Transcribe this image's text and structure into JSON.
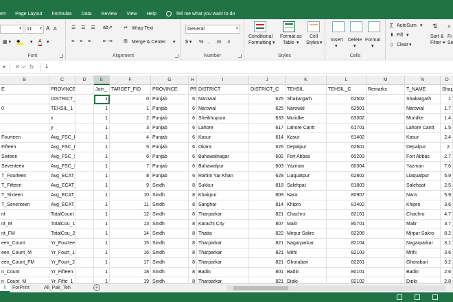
{
  "menu": {
    "items": [
      "ert",
      "Page Layout",
      "Formulas",
      "Data",
      "Review",
      "View",
      "Help"
    ],
    "tell_me": "Tell me what you want to do"
  },
  "ribbon": {
    "font_name": "",
    "font_size": "11",
    "number_format": "General",
    "wrap_text": "Wrap Text",
    "merge_center": "Merge & Center",
    "conditional_formatting_1": "Conditional",
    "conditional_formatting_2": "Formatting",
    "format_as_table_1": "Format as",
    "format_as_table_2": "Table",
    "cell_styles_1": "Cell",
    "cell_styles_2": "Styles",
    "insert": "Insert",
    "delete": "Delete",
    "format": "Format",
    "autosum": "AutoSum",
    "fill": "Fill",
    "clear": "Clear",
    "sort_filter_1": "Sort &",
    "sort_filter_2": "Filter",
    "find_select": "Fi",
    "find_select_2": "Se",
    "groups": {
      "font": "Font",
      "alignment": "Alignment",
      "number": "Number",
      "styles": "Styles",
      "cells": "Cells"
    }
  },
  "formula_bar": {
    "value": "1"
  },
  "columns": [
    "B",
    "C",
    "D",
    "E",
    "F",
    "G",
    "H",
    "I",
    "J",
    "K",
    "L",
    "M",
    "N",
    "O"
  ],
  "header_row": [
    "E",
    "PROVINCE_1",
    "",
    "Join_",
    "TARGET_FID",
    "PROVINCE",
    "PR",
    "DISTRICT",
    "DISTRICT_C",
    "TEHSIL",
    "TEHSIL_C",
    "Remarks",
    "T_NAME",
    "Shap"
  ],
  "rows": [
    [
      "",
      "DISTRICT_1",
      "",
      "1",
      "0",
      "Punjab",
      "6",
      "Narowal",
      "625",
      "Shakargarh",
      "62502",
      "",
      "Shakargarh",
      "1"
    ],
    [
      "0",
      "TEHSIL_1",
      "",
      "1",
      "1",
      "Punjab",
      "6",
      "Narowal",
      "625",
      "Narowal",
      "62501",
      "",
      "Narowal",
      "1.7"
    ],
    [
      "",
      "x",
      "",
      "1",
      "2",
      "Punjab",
      "6",
      "Sheikhupura",
      "633",
      "Muridke",
      "63302",
      "",
      "Muridke",
      "1.4"
    ],
    [
      "",
      "y",
      "",
      "1",
      "3",
      "Punjab",
      "6",
      "Lahore",
      "617",
      "Lahore Cantt",
      "61701",
      "",
      "Lahore Cantt",
      "1.5"
    ],
    [
      "Fourteen",
      "Avg_FSC_Fo",
      "",
      "1",
      "4",
      "Punjab",
      "6",
      "Kasur",
      "614",
      "Kasur",
      "61402",
      "",
      "Kasur",
      "2.4"
    ],
    [
      "Fifteen",
      "Avg_FSC_Fi",
      "",
      "1",
      "5",
      "Punjab",
      "6",
      "Okara",
      "626",
      "Depalpur",
      "62601",
      "",
      "Depalpur",
      "2."
    ],
    [
      "Sixteen",
      "Avg_FSC_Si",
      "",
      "1",
      "6",
      "Punjab",
      "6",
      "Bahawalnagar",
      "602",
      "Fort Abbas",
      "60203",
      "",
      "Fort Abbas",
      "2.7"
    ],
    [
      "Seventeen",
      "Avg_FSC_Se",
      "",
      "1",
      "7",
      "Punjab",
      "6",
      "Bahawalpur",
      "603",
      "Yazman",
      "60304",
      "",
      "Yazman",
      "7.6"
    ],
    [
      "T_Fourteen",
      "Avg_ECAT_F",
      "",
      "1",
      "8",
      "Punjab",
      "6",
      "Rahim Yar Khan",
      "628",
      "Liaquatpur",
      "62802",
      "",
      "Liaquatpur",
      "5.9"
    ],
    [
      "T_Fifteen",
      "Avg_ECAT_1",
      "",
      "1",
      "9",
      "Sindh",
      "8",
      "Sukkur",
      "818",
      "Salehpat",
      "81803",
      "",
      "Salehpat",
      "2.5"
    ],
    [
      "T_Sixteen",
      "Avg_ECAT_S",
      "",
      "1",
      "10",
      "Sindh",
      "8",
      "Khairpur",
      "809",
      "Nara",
      "80907",
      "",
      "Nara",
      "5.9"
    ],
    [
      "T_Seventeen",
      "Avg_ECAT_2",
      "",
      "1",
      "11",
      "Sindh",
      "8",
      "Sanghar",
      "814",
      "Khipro",
      "81402",
      "",
      "Khipro",
      "3.6"
    ],
    [
      "nt",
      "TotalCount",
      "",
      "1",
      "12",
      "Sindh",
      "8",
      "Tharparkar",
      "821",
      "Chachro",
      "82101",
      "",
      "Chachro",
      "4.7"
    ],
    [
      "nt_M",
      "TotalCou_1",
      "",
      "1",
      "13",
      "Sindh",
      "8",
      "Karachi City",
      "807",
      "Malir",
      "80701",
      "",
      "Malir",
      "3.7"
    ],
    [
      "nt_FM",
      "TotalCou_2",
      "",
      "1",
      "14",
      "Sindh",
      "8",
      "Thatta",
      "822",
      "Mirpur Sakro",
      "82206",
      "",
      "Mirpur Sakro",
      "8.2"
    ],
    [
      "een_Count",
      "Yr_Fourtee",
      "",
      "1",
      "15",
      "Sindh",
      "8",
      "Tharparkar",
      "821",
      "Nagarparkar",
      "82104",
      "",
      "Nagarparkar",
      "3.1"
    ],
    [
      "een_Count_M",
      "Yr_Fourt_1",
      "",
      "1",
      "16",
      "Sindh",
      "8",
      "Tharparkar",
      "821",
      "Mithi",
      "82103",
      "",
      "Mithi",
      "3.6"
    ],
    [
      "een_Count_FM",
      "Yr_Fourt_2",
      "",
      "1",
      "17",
      "Sindh",
      "8",
      "Tharparkar",
      "821",
      "Ghorabari",
      "82201",
      "",
      "Ghorabari",
      "3.2"
    ],
    [
      "n_Count",
      "Yr_Fifteen",
      "",
      "1",
      "18",
      "Sindh",
      "8",
      "Badin",
      "801",
      "Badin",
      "80101",
      "",
      "Badin",
      "2.6"
    ],
    [
      "n_Count_M",
      "Yr_Fifte_1",
      "",
      "1",
      "19",
      "Sindh",
      "8",
      "Tharparkar",
      "821",
      "Diplo",
      "82102",
      "",
      "Diplo",
      "2.8"
    ],
    [
      "n_Count_FM",
      "Yr_Fifte_2",
      "",
      "1",
      "20",
      "Sindh",
      "8",
      "Thatta",
      "822",
      "Keti Bander",
      "82203",
      "",
      "Keti Bander",
      "2.3"
    ]
  ],
  "sheets": [
    "l",
    "ForPrint",
    "All_Pak_Teh"
  ],
  "add_sheet": "+"
}
